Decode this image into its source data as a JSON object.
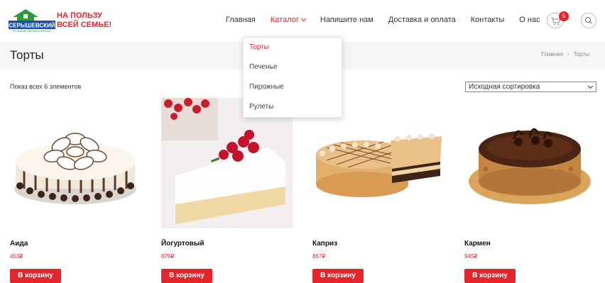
{
  "brand": {
    "logo_text": "СЕРЫШЕВСКИЙ",
    "logo_subtext": "ПРОИЗВОДСТВЕННЫЙ КОМПЛЕКС",
    "slogan_line1": "НА ПОЛЬЗУ",
    "slogan_line2": "ВСЕЙ СЕМЬЕ!"
  },
  "nav": {
    "items": [
      {
        "label": "Главная"
      },
      {
        "label": "Каталог"
      },
      {
        "label": "Напишите нам"
      },
      {
        "label": "Доставка и оплата"
      },
      {
        "label": "Контакты"
      },
      {
        "label": "О нас"
      }
    ],
    "cart_count": "5"
  },
  "dropdown": {
    "items": [
      {
        "label": "Торты"
      },
      {
        "label": "Печенье"
      },
      {
        "label": "Пирожные"
      },
      {
        "label": "Рулеты"
      }
    ]
  },
  "page": {
    "title": "Торты",
    "breadcrumb_home": "Главная",
    "breadcrumb_current": "Торты",
    "result_count": "Показ всех 6 элементов",
    "sort_selected": "Исходная сортировка"
  },
  "products": [
    {
      "name": "Аида",
      "price": "453₽",
      "button": "В корзину"
    },
    {
      "name": "Йогуртовый",
      "price": "679₽",
      "button": "В корзину"
    },
    {
      "name": "Каприз",
      "price": "867₽",
      "button": "В корзину"
    },
    {
      "name": "Кармен",
      "price": "945₽",
      "button": "В корзину"
    }
  ],
  "colors": {
    "accent": "#e5242b",
    "logo_green": "#2e9a3a",
    "logo_blue": "#1f4fa3",
    "title_bar_bg": "#f6f6f6"
  },
  "icons": [
    "cart-icon",
    "search-icon",
    "chevron-down-icon",
    "breadcrumb-separator-icon"
  ]
}
